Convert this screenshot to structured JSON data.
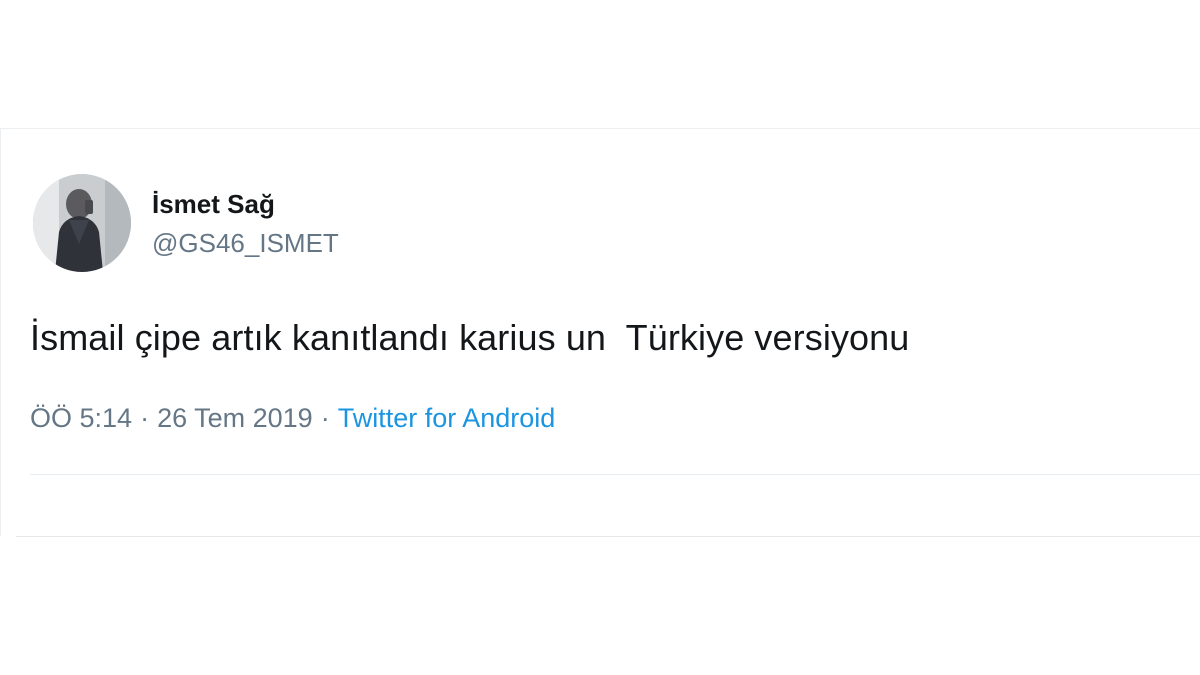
{
  "tweet": {
    "display_name": "İsmet Sağ",
    "handle": "@GS46_ISMET",
    "text": "İsmail çipe artık kanıtlandı karius un  Türkiye versiyonu",
    "time": "ÖÖ 5:14",
    "separator": "·",
    "date": "26 Tem 2019",
    "source": "Twitter for Android"
  },
  "colors": {
    "text": "#14171a",
    "secondary": "#657786",
    "link": "#1b95e0",
    "divider": "#e6ecf0"
  },
  "icons": {
    "avatar": "user-avatar-photo"
  }
}
